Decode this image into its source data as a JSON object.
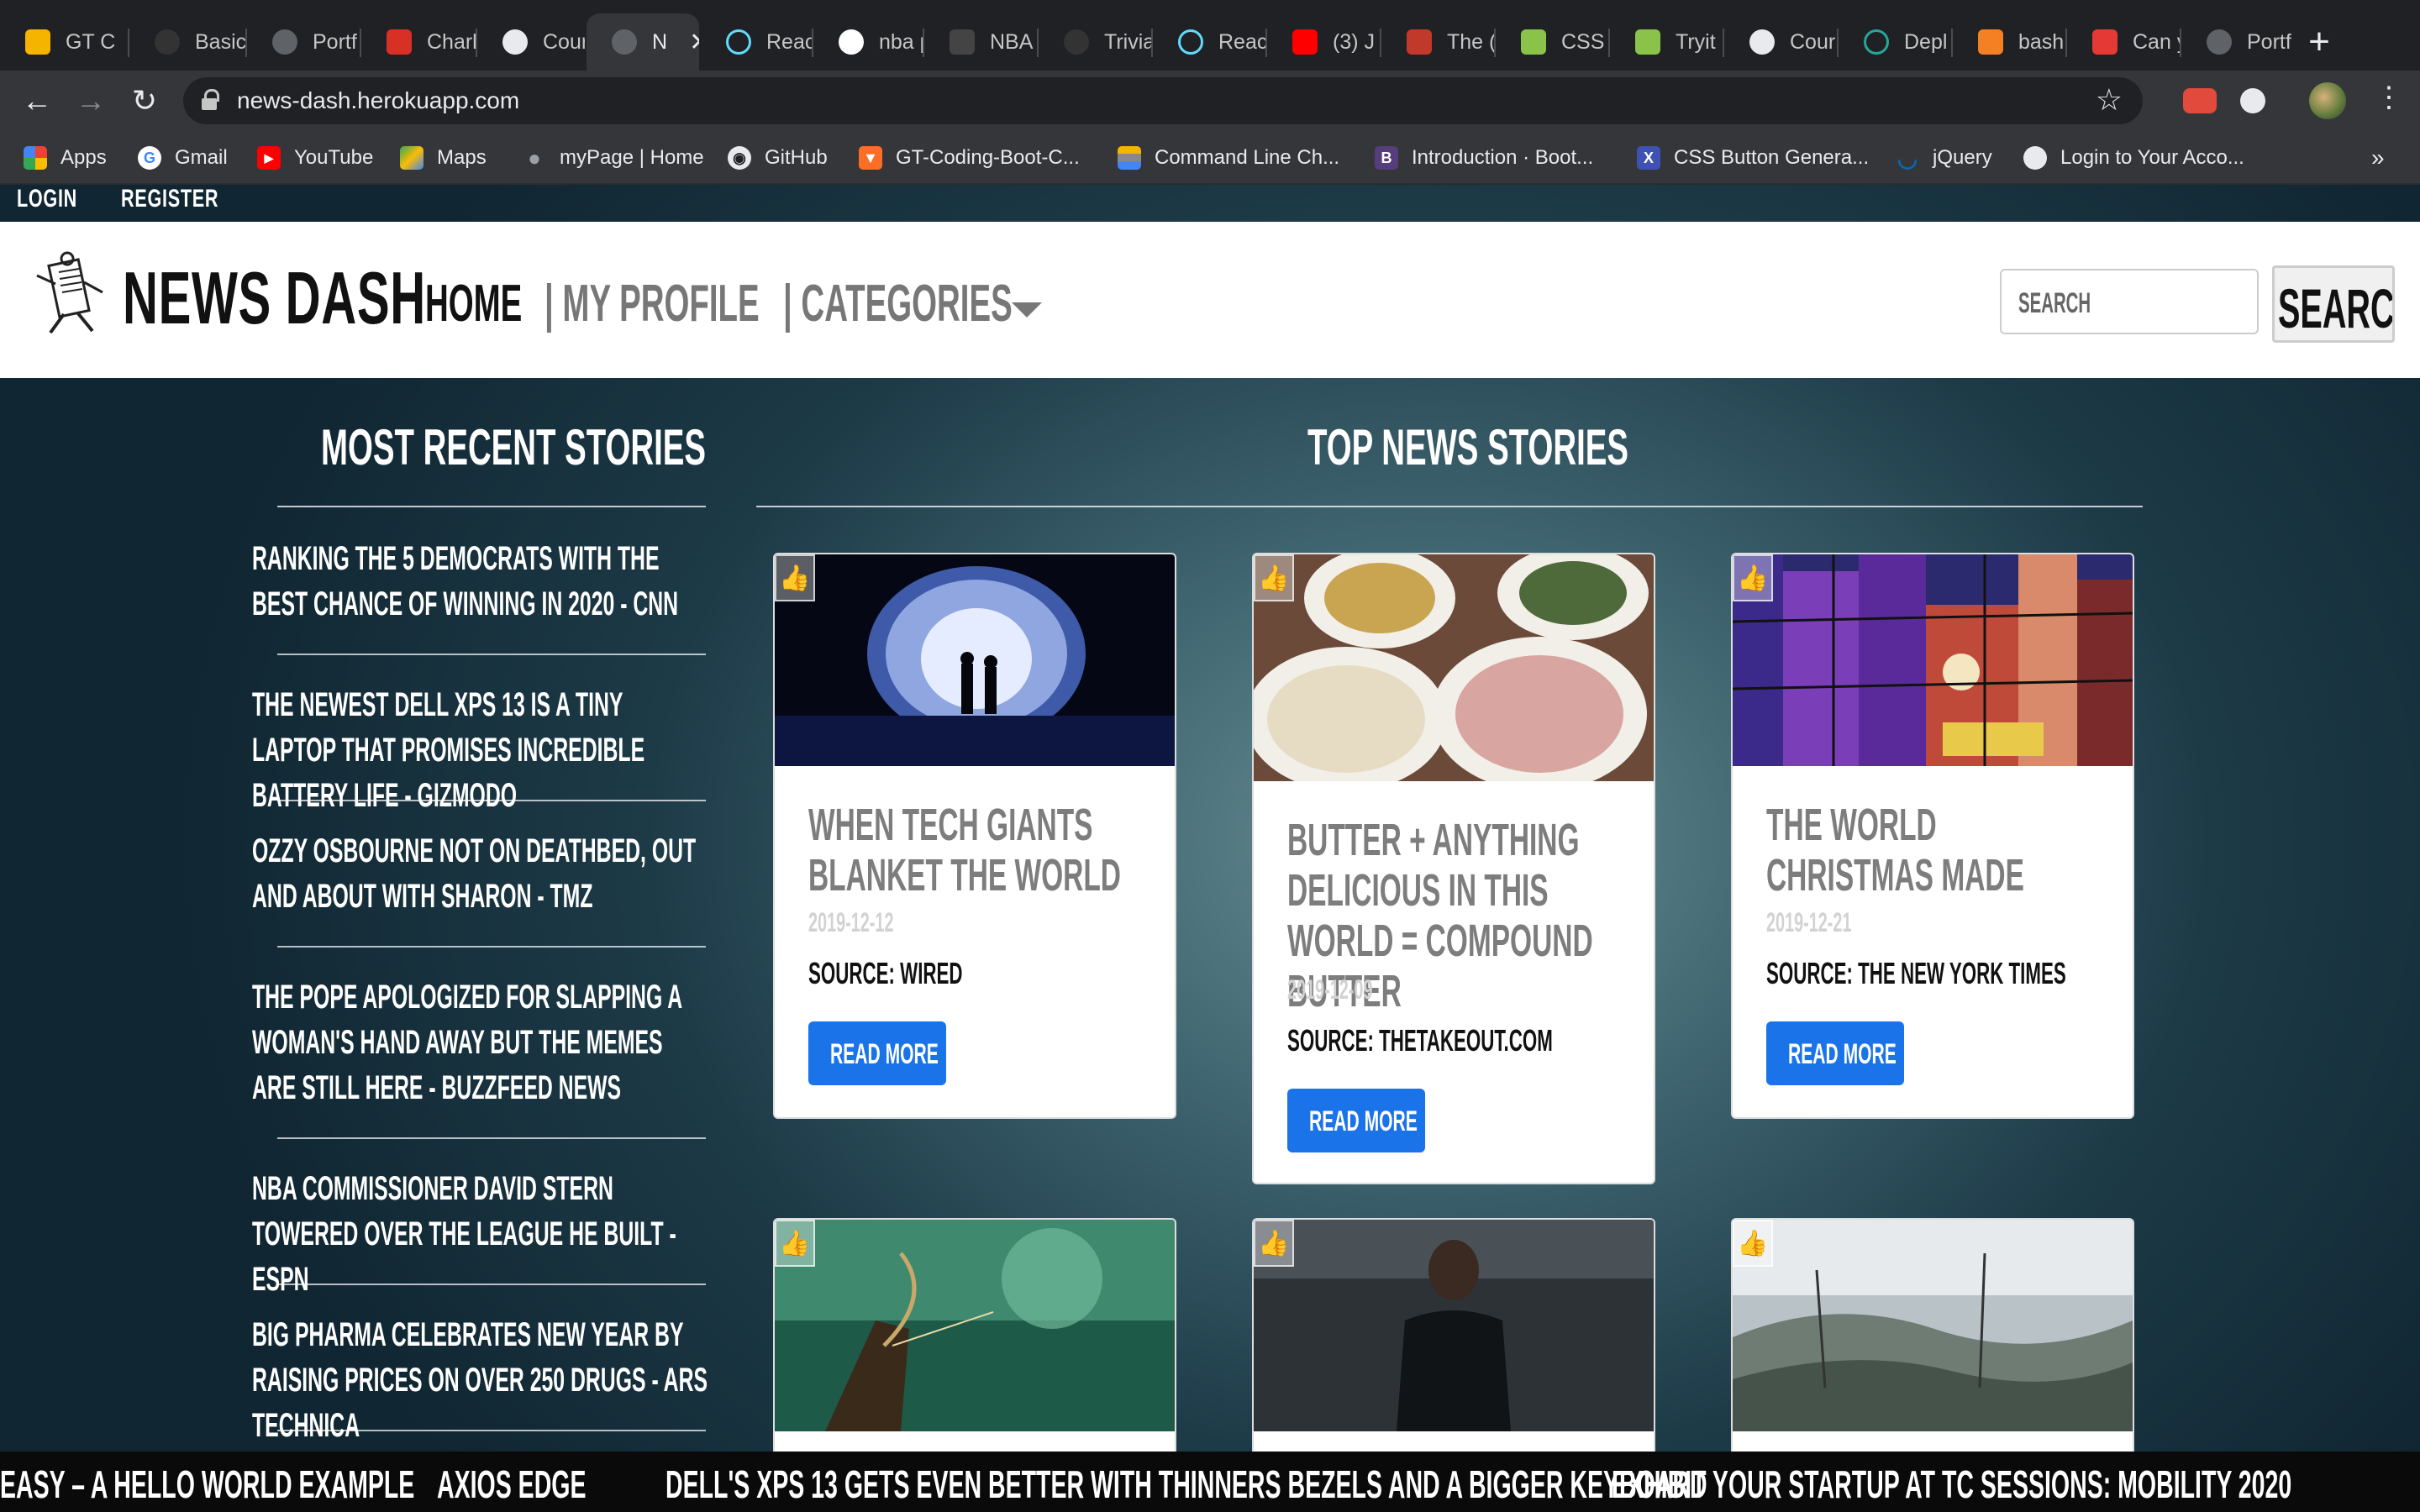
{
  "browser": {
    "tabs": [
      {
        "label": "GT C",
        "color": "#f4b400"
      },
      {
        "label": "Basic",
        "color": "#333333"
      },
      {
        "label": "Portf",
        "color": "#5f6368"
      },
      {
        "label": "Charl",
        "color": "#d93025"
      },
      {
        "label": "Cour",
        "color": "#e8eaed"
      },
      {
        "label": "N",
        "color": "#5f6368",
        "active": true
      },
      {
        "label": "Reac",
        "color": "#61dafb"
      },
      {
        "label": "nba p",
        "color": "#ffffff"
      },
      {
        "label": "NBA",
        "color": "#444444"
      },
      {
        "label": "Trivia",
        "color": "#333333"
      },
      {
        "label": "Reac",
        "color": "#61dafb"
      },
      {
        "label": "(3) J",
        "color": "#ff0000"
      },
      {
        "label": "The (",
        "color": "#c0392b"
      },
      {
        "label": "CSS",
        "color": "#8bc34a"
      },
      {
        "label": "Tryit",
        "color": "#8bc34a"
      },
      {
        "label": "Cour",
        "color": "#e8eaed"
      },
      {
        "label": "Depl",
        "color": "#26a69a"
      },
      {
        "label": "bash",
        "color": "#f48024"
      },
      {
        "label": "Can y",
        "color": "#e53935"
      },
      {
        "label": "Portf",
        "color": "#5f6368"
      }
    ],
    "url": "news-dash.herokuapp.com",
    "bookmarks": [
      {
        "label": "Apps",
        "icon": "apps-grid-icon",
        "color": "#4285f4"
      },
      {
        "label": "Gmail",
        "icon": "google-icon",
        "color": "#ffffff"
      },
      {
        "label": "YouTube",
        "icon": "youtube-icon",
        "color": "#ff0000"
      },
      {
        "label": "Maps",
        "icon": "maps-icon",
        "color": "#34a853"
      },
      {
        "label": "myPage | Home",
        "icon": "apple-icon",
        "color": "#9aa0a6"
      },
      {
        "label": "GitHub",
        "icon": "github-icon",
        "color": "#e8eaed"
      },
      {
        "label": "GT-Coding-Boot-C...",
        "icon": "gitlab-icon",
        "color": "#fc6d26"
      },
      {
        "label": "Command Line Ch...",
        "icon": "stack-icon",
        "color": "#f4b400"
      },
      {
        "label": "Introduction · Boot...",
        "icon": "bootstrap-icon",
        "color": "#563d7c"
      },
      {
        "label": "CSS Button Genera...",
        "icon": "x-icon",
        "color": "#3f51b5"
      },
      {
        "label": "jQuery",
        "icon": "jquery-icon",
        "color": "#0769ad"
      },
      {
        "label": "Login to Your Acco...",
        "icon": "globe-icon",
        "color": "#e8eaed"
      }
    ]
  },
  "site": {
    "auth": {
      "login": "LOGIN",
      "register": "REGISTER"
    },
    "brand": "NEWS DASH",
    "nav": {
      "home": "HOME",
      "profile": "| MY PROFILE",
      "categories": "| CATEGORIES"
    },
    "search": {
      "placeholder": "SEARCH",
      "button": "SEARCH"
    },
    "recent_title": "MOST RECENT STORIES",
    "top_title": "TOP NEWS STORIES",
    "recent": [
      "Ranking the 5 Democrats with the best chance of winning in 2020 - CNN",
      "The newest Dell XPS 13 is a tiny laptop that promises incredible battery life - Gizmodo",
      "Ozzy Osbourne Not on Deathbed, Out and About with Sharon - TMZ",
      "The Pope apologized for slapping a woman's hand away but the memes are still here - BuzzFeed News",
      "NBA commissioner David Stern towered over the league he built - ESPN",
      "Big Pharma celebrates new year by raising prices on over 250 drugs - Ars Technica"
    ],
    "cards": [
      {
        "title": "When Tech Giants Blanket the World",
        "date": "2019-12-12",
        "source": "SOURCE: WIRED",
        "button": "READ MORE"
      },
      {
        "title": "Butter + Anything Delicious in This World = Compound Butter",
        "date": "2019-12-09",
        "source": "SOURCE: THETAKEOUT.COM",
        "button": "READ MORE"
      },
      {
        "title": "The World Christmas Made",
        "date": "2019-12-21",
        "source": "SOURCE: THE NEW YORK TIMES",
        "button": "READ MORE"
      }
    ],
    "ticker": [
      "EASY – A HELLO WORLD EXAMPLE",
      "AXIOS EDGE",
      "DELL'S XPS 13 GETS EVEN BETTER WITH THINNERS BEZELS AND A BIGGER KEYBOARD",
      "EXHIBIT YOUR STARTUP AT TC SESSIONS: MOBILITY 2020"
    ],
    "accent_color": "#1a73e8"
  }
}
